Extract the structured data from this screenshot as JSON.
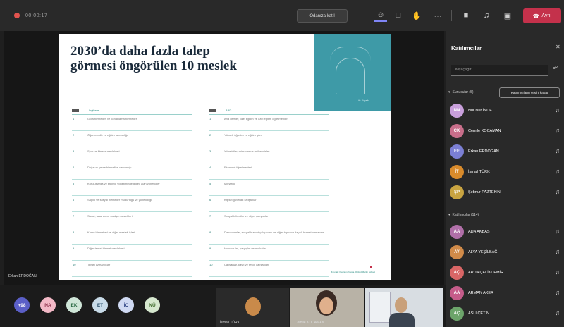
{
  "meeting": {
    "timer": "00:00:17",
    "top_action": "Odanıza katıl",
    "leave_label": "Ayrıl",
    "presenter_name": "Erkan ERDOĞAN"
  },
  "slide": {
    "title": "2030’da daha fazla talep görmesi öngörülen 10 meslek",
    "image_caption": "ör. ölçek",
    "left_header": "İngiltere",
    "right_header": "ABD",
    "left_rows": [
      {
        "num": "1",
        "text": "Gıda hizmetleri ve konaklama hizmetleri"
      },
      {
        "num": "2",
        "text": "Öğretmenlik ve eğitim uzmanlığı"
      },
      {
        "num": "3",
        "text": "Spor ve fitness meslekleri"
      },
      {
        "num": "4",
        "text": "Doğa ve çevre hizmetleri uzmanlığı"
      },
      {
        "num": "5",
        "text": "Kuruluşlarda ve etkinlik yönetiminde görev alan yöneticiler"
      },
      {
        "num": "6",
        "text": "Sağlık ve sosyal hizmetler müdürlüğü ve yöneticiliği"
      },
      {
        "num": "7",
        "text": "Sanat, tasarım ve medya meslekleri"
      },
      {
        "num": "8",
        "text": "Kamu hizmetleri ve diğer meslek işleri"
      },
      {
        "num": "9",
        "text": "Diğer temel hizmet meslekleri"
      },
      {
        "num": "10",
        "text": "Temel uzmanlıklar"
      }
    ],
    "right_rows": [
      {
        "num": "1",
        "text": "Ana dersler, özel eğitim ve özel eğitim öğretmenleri"
      },
      {
        "num": "2",
        "text": "Yüksek öğretim ve eğitim işleri"
      },
      {
        "num": "3",
        "text": "Yöneticiler, mimarlar ve mühendisler"
      },
      {
        "num": "4",
        "text": "Ekonomi öğretmenleri"
      },
      {
        "num": "5",
        "text": "Mimarlık"
      },
      {
        "num": "6",
        "text": "Kişisel güvenlik çalışanları"
      },
      {
        "num": "7",
        "text": "Sosyal bilimciler ve diğer çalışanlar"
      },
      {
        "num": "8",
        "text": "Danışmanlar, sosyal hizmet çalışanları ve diğer topluma dayalı hizmet uzmanları"
      },
      {
        "num": "9",
        "text": "Hukukçular, yargıçlar ve avukatlar"
      },
      {
        "num": "10",
        "text": "Çalışanlar, kayıt ve tescil çalışanları"
      }
    ],
    "footer": "Kaynak: Pearson, Nesta, Oxford Martin School"
  },
  "panel": {
    "title": "Katılımcılar",
    "search_placeholder": "Kişi çağır",
    "presenters_label": "Sunucular (5)",
    "mute_all_label": "Katılımcıların sesini kapat",
    "attendees_label": "Katılımcılar (114)",
    "presenters": [
      {
        "name": "Nur Nur İNCE",
        "initials": "NN",
        "color": "#c9a0dc"
      },
      {
        "name": "Cemile KOCAMAN",
        "initials": "CK",
        "color": "#c86e8a"
      },
      {
        "name": "Erkan ERDOĞAN",
        "initials": "EE",
        "color": "#7b7fd4"
      },
      {
        "name": "İsmail TÜRK",
        "initials": "İT",
        "color": "#d98b2b"
      },
      {
        "name": "Şebnur PAZTEKİN",
        "initials": "ŞP",
        "color": "#c9a441"
      }
    ],
    "attendees": [
      {
        "name": "ADA AKBAŞ",
        "initials": "AA",
        "color": "#b06fa8"
      },
      {
        "name": "ALYA YEŞİLBAĞ",
        "initials": "AY",
        "color": "#d18b49"
      },
      {
        "name": "ARDA ÇELİKDEMİR",
        "initials": "AÇ",
        "color": "#d96666"
      },
      {
        "name": "ARMAN AKER",
        "initials": "AA",
        "color": "#c55c8a"
      },
      {
        "name": "ASLI ÇETİN",
        "initials": "AÇ",
        "color": "#6ca46a"
      }
    ]
  },
  "strip": {
    "tiles": [
      {
        "label": "+98",
        "bg": "#5b5fc7",
        "fg": "#ffffff"
      },
      {
        "label": "NA",
        "bg": "#f2b8c6",
        "fg": "#8a2a45"
      },
      {
        "label": "EK",
        "bg": "#cfe6d8",
        "fg": "#2a6a44"
      },
      {
        "label": "ET",
        "bg": "#c8dbe8",
        "fg": "#2a4f6a"
      },
      {
        "label": "İC",
        "bg": "#cfd9f2",
        "fg": "#2a3f80"
      },
      {
        "label": "NÜ",
        "bg": "#d6e8cf",
        "fg": "#3d6a2a"
      }
    ],
    "video1_label": "İsmail TÜRK",
    "video2_label": "Cemile KOCAMAN"
  },
  "colors": {
    "accent": "#7f85f5",
    "leave": "#c4314b",
    "slide_teal": "#3e9aa7"
  }
}
